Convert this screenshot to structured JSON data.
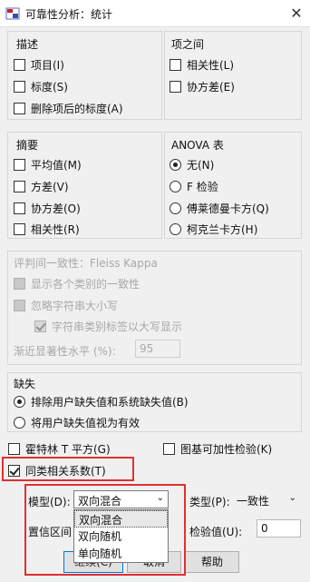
{
  "window": {
    "title": "可靠性分析：统计",
    "close": "✕",
    "icon": "spss-icon"
  },
  "descriptives": {
    "title": "描述",
    "items": [
      {
        "label": "项目(I)",
        "checked": false
      },
      {
        "label": "标度(S)",
        "checked": false
      },
      {
        "label": "删除项后的标度(A)",
        "checked": false
      }
    ]
  },
  "inter_item": {
    "title": "项之间",
    "items": [
      {
        "label": "相关性(L)",
        "checked": false
      },
      {
        "label": "协方差(E)",
        "checked": false
      }
    ]
  },
  "summaries": {
    "title": "摘要",
    "items": [
      {
        "label": "平均值(M)",
        "checked": false
      },
      {
        "label": "方差(V)",
        "checked": false
      },
      {
        "label": "协方差(O)",
        "checked": false
      },
      {
        "label": "相关性(R)",
        "checked": false
      }
    ]
  },
  "anova": {
    "title": "ANOVA 表",
    "options": [
      {
        "label": "无(N)",
        "selected": true
      },
      {
        "label": "F 检验",
        "selected": false
      },
      {
        "label": "傅莱德曼卡方(Q)",
        "selected": false
      },
      {
        "label": "柯克兰卡方(H)",
        "selected": false
      }
    ]
  },
  "fleiss": {
    "title": "评判间一致性：Fleiss Kappa",
    "show_categories": "显示各个类别的一致性",
    "ignore_case": "忽略字符串大小写",
    "uppercase_labels": "字符串类别标签以大写显示",
    "asym_label": "渐近显著性水平 (%):",
    "asym_value": "95"
  },
  "missing": {
    "title": "缺失",
    "options": [
      {
        "label": "排除用户缺失值和系统缺失值(B)",
        "selected": true
      },
      {
        "label": "将用户缺失值视为有效",
        "selected": false
      }
    ]
  },
  "extras": {
    "hotelling": "霍特林 T 平方(G)",
    "tukey": "图基可加性检验(K)",
    "icc": "同类相关系数(T)"
  },
  "icc_options": {
    "model_label": "模型(D):",
    "model_value": "双向混合",
    "model_options": [
      "双向混合",
      "双向随机",
      "单向随机"
    ],
    "type_label": "类型(P):",
    "type_value": "一致性",
    "ci_label": "置信区间",
    "test_label": "检验值(U):",
    "test_value": "0"
  },
  "buttons": {
    "continue": "继续(C)",
    "cancel": "取消",
    "help": "帮助"
  },
  "colors": {
    "highlight": "#e03030",
    "background": "#f0f0f0"
  }
}
